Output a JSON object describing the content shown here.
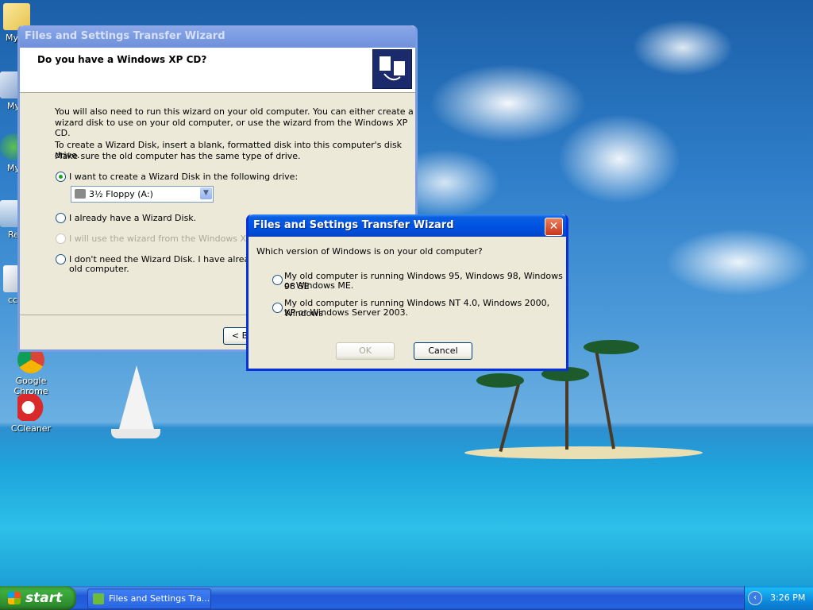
{
  "desktop": {
    "icons": [
      {
        "label": "My D",
        "icon": "folder-documents-icon"
      },
      {
        "label": "My",
        "icon": "my-computer-icon"
      },
      {
        "label": "My",
        "icon": "network-places-icon"
      },
      {
        "label": "Re",
        "icon": "recycle-bin-icon"
      },
      {
        "label": "ccle",
        "icon": "installer-icon"
      },
      {
        "label": "Google Chrome",
        "icon": "chrome-icon"
      },
      {
        "label": "CCleaner",
        "icon": "ccleaner-icon"
      }
    ]
  },
  "wizard": {
    "title": "Files and Settings Transfer Wizard",
    "heading": "Do you have a Windows XP CD?",
    "para1_line1": "You will also need to run this wizard on your old computer. You can either create a",
    "para1_line2": "wizard disk to use on your old computer, or use the wizard from the Windows XP CD.",
    "para2_line1": "To create a Wizard Disk, insert a blank, formatted disk into this computer's disk drive.",
    "para2_line2": "Make sure the old computer has the same type of drive.",
    "option1": "I want to create a Wizard Disk in the following drive:",
    "drive_selected": "3½ Floppy (A:)",
    "option2": "I already have a Wizard Disk.",
    "option3": "I will use the wizard from the Windows XP CD.",
    "option4_line1": "I don't need the Wizard Disk. I have already coll",
    "option4_line2": "old computer.",
    "back_button": "< B"
  },
  "dialog": {
    "title": "Files and Settings Transfer Wizard",
    "question": "Which version of Windows is on your old computer?",
    "choice1_line1": "My old computer is running Windows 95, Windows 98, Windows 98 SE",
    "choice1_line2": "or Windows ME.",
    "choice2_line1": "My old computer is running Windows NT 4.0, Windows 2000, Windows",
    "choice2_line2": "XP or Windows Server 2003.",
    "ok_label": "OK",
    "cancel_label": "Cancel"
  },
  "taskbar": {
    "start_label": "start",
    "task_label": "Files and Settings Tra...",
    "clock": "3:26 PM"
  },
  "colors": {
    "xp_blue": "#0054e3",
    "close_red": "#e0542f",
    "start_green": "#3dad3d"
  }
}
